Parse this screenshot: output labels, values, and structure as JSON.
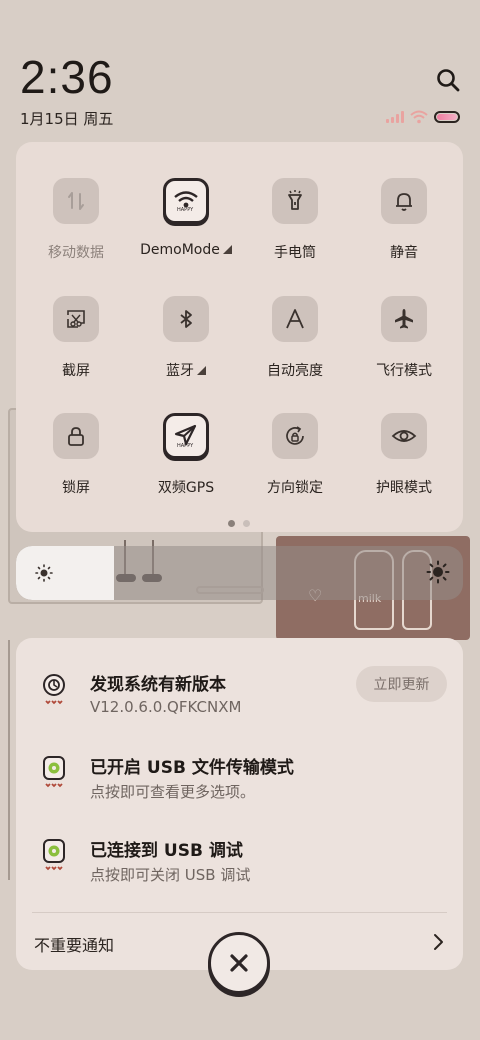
{
  "status_bar": {
    "time": "2:36",
    "date": "1月15日 周五",
    "icons": [
      "search-icon",
      "signal-icon",
      "wifi-icon",
      "battery-icon"
    ]
  },
  "quick_settings": {
    "tiles": [
      {
        "label": "移动数据",
        "icon": "mobile-data-icon",
        "state": "disabled"
      },
      {
        "label": "DemoMode",
        "icon": "wifi-icon",
        "state": "on",
        "has_menu": true
      },
      {
        "label": "手电筒",
        "icon": "flashlight-icon",
        "state": "off"
      },
      {
        "label": "静音",
        "icon": "bell-icon",
        "state": "off"
      },
      {
        "label": "截屏",
        "icon": "screenshot-icon",
        "state": "off"
      },
      {
        "label": "蓝牙",
        "icon": "bluetooth-icon",
        "state": "off",
        "has_menu": true
      },
      {
        "label": "自动亮度",
        "icon": "auto-brightness-icon",
        "state": "off"
      },
      {
        "label": "飞行模式",
        "icon": "airplane-icon",
        "state": "off"
      },
      {
        "label": "锁屏",
        "icon": "lock-icon",
        "state": "off"
      },
      {
        "label": "双频GPS",
        "icon": "gps-icon",
        "state": "on"
      },
      {
        "label": "方向锁定",
        "icon": "rotation-lock-icon",
        "state": "off"
      },
      {
        "label": "护眼模式",
        "icon": "eye-icon",
        "state": "off"
      }
    ],
    "page_count": 2,
    "current_page": 1
  },
  "brightness": {
    "level": 0.22
  },
  "notifications": [
    {
      "title": "发现系统有新版本",
      "subtitle": "V12.0.6.0.QFKCNXM",
      "action": "立即更新",
      "icon": "update-icon"
    },
    {
      "title": "已开启 USB 文件传输模式",
      "subtitle": "点按即可查看更多选项。",
      "icon": "android-usb-icon"
    },
    {
      "title": "已连接到 USB 调试",
      "subtitle": "点按即可关闭 USB 调试",
      "icon": "android-usb-icon"
    }
  ],
  "footer": {
    "label": "不重要通知"
  },
  "colors": {
    "panel": "#e8dcd6",
    "tile": "#cec2bc",
    "accent_battery": "#ef7ea0"
  }
}
